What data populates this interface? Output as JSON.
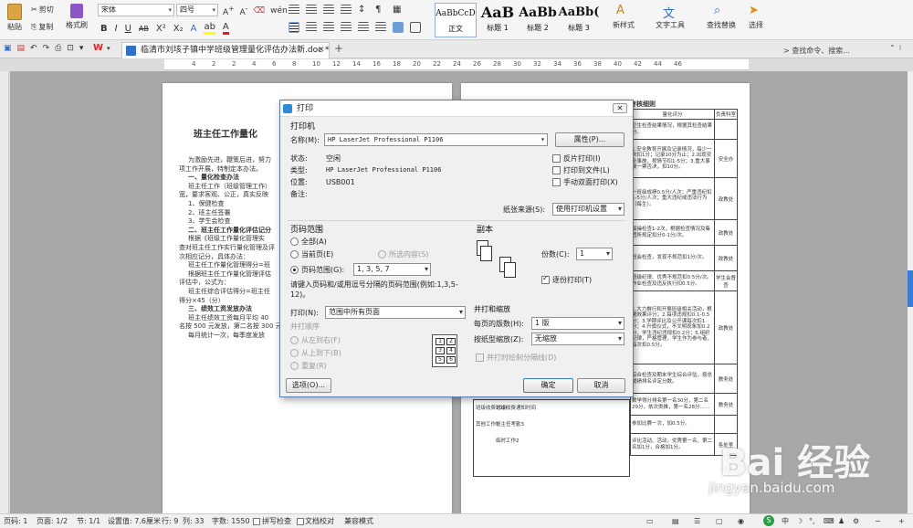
{
  "ribbon": {
    "paste_label": "粘贴",
    "cut_label": "剪切",
    "copy_label": "复制",
    "format_painter_label": "格式刷",
    "font_name": "宋体",
    "font_size": "四号",
    "styles": [
      {
        "preview": "AaBbCcD",
        "label": "正文"
      },
      {
        "preview": "AaB",
        "label": "标题 1"
      },
      {
        "preview": "AaBb",
        "label": "标题 2"
      },
      {
        "preview": "AaBb(",
        "label": "标题 3"
      }
    ],
    "new_style_label": "新样式",
    "text_tools_label": "文字工具",
    "find_replace_label": "查找替换",
    "select_label": "选择"
  },
  "tabbar": {
    "doc_title": "临清市刘垓子镇中学班级管理量化评估办法新.doc *",
    "add_tab": "+",
    "search_hint": "查找命令、搜索..."
  },
  "ruler": {
    "ticks": [
      "4",
      "2",
      "2",
      "4",
      "6",
      "8",
      "10",
      "12",
      "14",
      "16",
      "18",
      "20",
      "22",
      "24",
      "26",
      "28",
      "30",
      "32",
      "34",
      "36",
      "38",
      "40",
      "42",
      "44",
      "46"
    ]
  },
  "left_page": {
    "title": "班主任工作量化",
    "lines": [
      "为激励先进，鞭策后进，努力",
      "项工作开展，特制定本办法。",
      "一、量化检查办法",
      "班主任工作（班级管理工作）",
      "宽，要求客观、公正，真实反映",
      "1、保健检查",
      "2、班主任签署",
      "3、学生会检查",
      "二、班主任工作量化评估记分",
      "根据《班级工作量化管理实",
      "查对班主任工作实行量化管理及评",
      "次相应记分，具体办法：",
      "班主任工作量化管理得分=班",
      "根据班主任工作量化管理评估",
      "评估中，公式为：",
      "班主任综合评估得分=班主任",
      "得分×45（分）",
      "三、绩效工资发放办法",
      "班主任绩效工资每月平均 40",
      "名按 500 元发放，第二名按 300 元",
      "每月统计一次，每季度发放"
    ]
  },
  "right_page": {
    "header": "考核细则",
    "col_headers": [
      "量化评分",
      "负责科室"
    ],
    "rows": [
      {
        "desc": "卫生检查结果情况，根据其检查结果分。",
        "dept": ""
      },
      {
        "desc": "1.安全教育开展及记录情况，每少一次扣1分；记录10分为止；2.出现安全事故，视情节扣1-5分；3.重大事故一票否决，扣10分。",
        "dept": "安全办"
      },
      {
        "desc": "一班级成绩0.5分/人次；严重违纪扣1-5分/人次；重大违纪或违法行为（每生）。",
        "dept": "政教处"
      },
      {
        "desc": "晨操检查1-2次，根据检查情况及集团所规定扣分0-1分/次。",
        "dept": "政教处"
      },
      {
        "desc": "班会检查，发现不规范扣1分/次。",
        "dept": "政教处"
      },
      {
        "desc": "班级纪律、优秀不规范扣0.5分/次。作业检查及违反执行扣0.5分。",
        "dept": "学生会督查"
      },
      {
        "desc": "1.大力推行和开展班级相关活动，根据效果评分；2.每项违规扣0.1-0.5分；3.学期评比及公开课每次扣1分；4.升旗仪式，不文明现象加0.2分，学生违纪违规扣0.2分；5.组织纪律，严格管理，学生作为参与者，每次扣0.5分。",
        "dept": "政教处"
      },
      {
        "desc": "综合检查及期末学生综合评估，按总成绩排名评定分数。",
        "dept": "教务处"
      },
      {
        "desc": "数学得分排名第一名30分，第二名29分，依次类推，第一名28分……",
        "dept": "教务处"
      },
      {
        "desc": "参加比赛一次，加0.5分。",
        "dept": ""
      },
      {
        "desc": "评比活动、活动，优秀第一名、第二名加1分，合格加1分。",
        "dept": "各处室"
      }
    ],
    "side_labels": [
      {
        "cat": "班级收费20分",
        "sub": "班级收费通知时间"
      },
      {
        "cat": "其他工作5",
        "sub": "班主任考勤3"
      },
      {
        "cat": "",
        "sub": "临时工作2"
      }
    ]
  },
  "print_dialog": {
    "title": "打印",
    "printer_section": "打印机",
    "name_label": "名称(M):",
    "printer_name": "HP LaserJet Professional P1106",
    "properties_button": "属性(P)...",
    "status_label": "状态:",
    "status_value": "空闲",
    "type_label": "类型:",
    "type_value": "HP LaserJet Professional P1106",
    "where_label": "位置:",
    "where_value": "USB001",
    "comment_label": "备注:",
    "reverse_print": "反片打印(I)",
    "print_to_file": "打印到文件(L)",
    "manual_duplex": "手动双面打印(X)",
    "paper_source_label": "纸张来源(S):",
    "paper_source_value": "使用打印机设置",
    "page_range_section": "页码范围",
    "range_all": "全部(A)",
    "range_current": "当前页(E)",
    "range_selection": "所选内容(S)",
    "range_pages": "页码范围(G):",
    "range_pages_value": "1, 3, 5, 7",
    "range_hint": "请键入页码和/或用逗号分隔的页码范围(例如:1,3,5-12)。",
    "copies_section": "副本",
    "copies_label": "份数(C):",
    "copies_value": "1",
    "collate": "逐份打印(T)",
    "print_what_label": "打印(N):",
    "print_what_value": "范围中所有页面",
    "order_section": "并打顺序",
    "order_lr": "从左到右(F)",
    "order_tb": "从上到下(B)",
    "order_repeat": "重复(R)",
    "zoom_section": "并打和缩放",
    "pages_per_sheet_label": "每页的版数(H):",
    "pages_per_sheet_value": "1 版",
    "scale_label": "按纸型缩放(Z):",
    "scale_value": "无缩放",
    "draw_borders": "并打时绘制分隔线(D)",
    "options_button": "选项(O)...",
    "ok_button": "确定",
    "cancel_button": "取消",
    "order_grid": [
      "1",
      "2",
      "3",
      "4",
      "5",
      "6"
    ]
  },
  "status_bar": {
    "page_num": "页码: 1",
    "pages": "页面: 1/2",
    "section": "节: 1/1",
    "position": "设置值: 7.6厘米",
    "row": "行: 9",
    "col": "列: 33",
    "words": "字数: 1550",
    "spell": "拼写检查",
    "doc_check": "文档校对",
    "compat": "兼容模式"
  },
  "watermark": {
    "brand": "Bai 经验",
    "url": "jingyan.baidu.com"
  }
}
